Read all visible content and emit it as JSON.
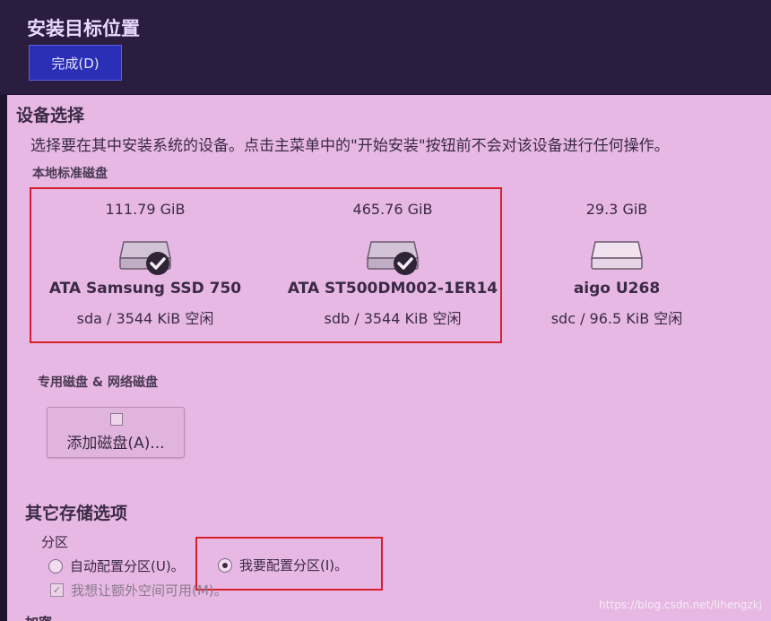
{
  "header": {
    "title": "安装目标位置",
    "done_label": "完成(D)"
  },
  "device_selection": {
    "title": "设备选择",
    "description": "选择要在其中安装系统的设备。点击主菜单中的\"开始安装\"按钮前不会对该设备进行任何操作。",
    "local_disks_title": "本地标准磁盘",
    "disks": [
      {
        "size": "111.79 GiB",
        "name": "ATA Samsung SSD 750",
        "free": "sda   /   3544 KiB 空闲",
        "selected": true
      },
      {
        "size": "465.76 GiB",
        "name": "ATA ST500DM002-1ER14",
        "free": "sdb   /   3544 KiB 空闲",
        "selected": true
      },
      {
        "size": "29.3 GiB",
        "name": "aigo U268",
        "free": "sdc  /  96.5 KiB 空闲",
        "selected": false
      }
    ],
    "special_disks_title": "专用磁盘 & 网络磁盘",
    "add_disk_label": "添加磁盘(A)..."
  },
  "other_storage": {
    "title": "其它存储选项",
    "partition_label": "分区",
    "auto_option": "自动配置分区(U)。",
    "manual_option": "我要配置分区(I)。",
    "extra_space_option": "我想让额外空间可用(M)。",
    "next_title_partial": "加密"
  },
  "watermark": "https://blog.csdn.net/lihengzkj",
  "colors": {
    "accent": "#2a2fb5",
    "panel": "#e7b8e3",
    "highlight": "#d81e2a"
  }
}
